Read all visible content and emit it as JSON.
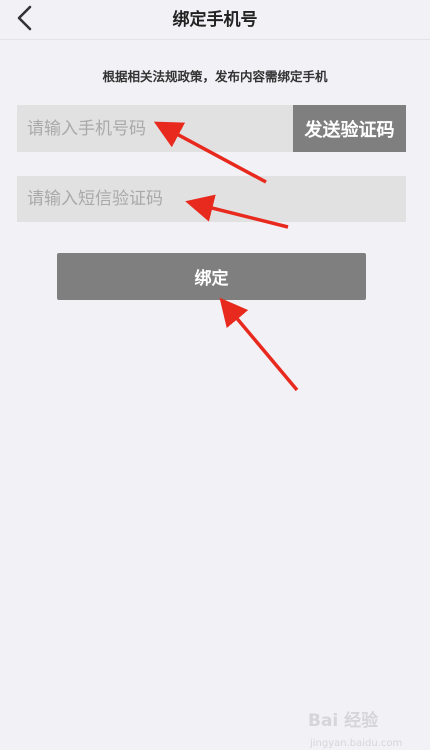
{
  "header": {
    "title": "绑定手机号"
  },
  "notice": "根据相关法规政策，发布内容需绑定手机",
  "phone": {
    "placeholder": "请输入手机号码",
    "value": ""
  },
  "send_code_button": "发送验证码",
  "code": {
    "placeholder": "请输入短信验证码",
    "value": ""
  },
  "bind_button": "绑定",
  "watermark": {
    "text": "Bai 经验",
    "sub": "jingyan.baidu.com"
  },
  "colors": {
    "background": "#f2f1f6",
    "input_bg": "#e1e1e1",
    "button_bg": "#7f7f7f",
    "arrow": "#e8291e"
  },
  "icons": {
    "back": "chevron-left-icon"
  }
}
